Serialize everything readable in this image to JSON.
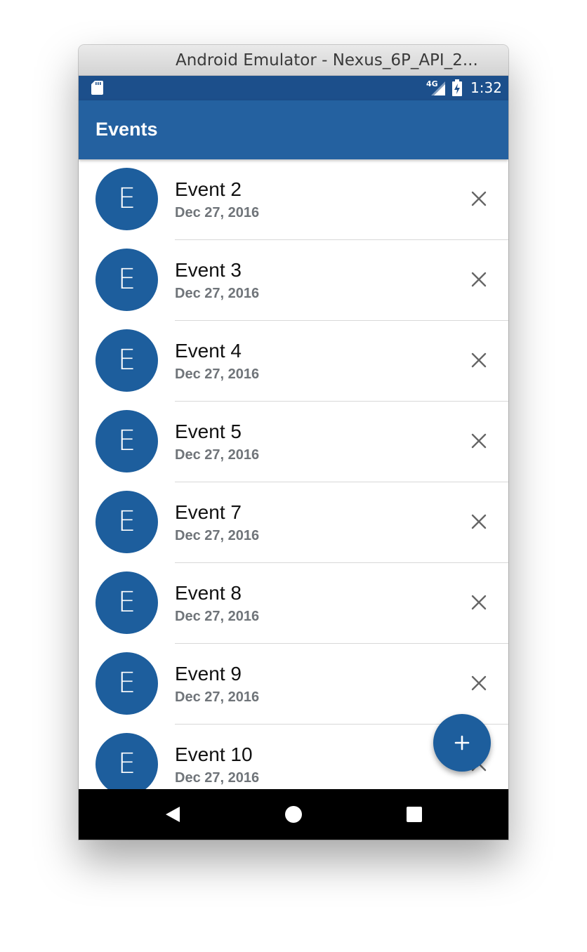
{
  "window": {
    "title": "Android Emulator - Nexus_6P_API_2..."
  },
  "status_bar": {
    "network_label": "4G",
    "time": "1:32",
    "icons": [
      "sd-card-icon",
      "signal-icon",
      "battery-charging-icon"
    ]
  },
  "app_bar": {
    "title": "Events"
  },
  "events": [
    {
      "avatar_letter": "E",
      "title": "Event 2",
      "date": "Dec 27, 2016"
    },
    {
      "avatar_letter": "E",
      "title": "Event 3",
      "date": "Dec 27, 2016"
    },
    {
      "avatar_letter": "E",
      "title": "Event 4",
      "date": "Dec 27, 2016"
    },
    {
      "avatar_letter": "E",
      "title": "Event 5",
      "date": "Dec 27, 2016"
    },
    {
      "avatar_letter": "E",
      "title": "Event 7",
      "date": "Dec 27, 2016"
    },
    {
      "avatar_letter": "E",
      "title": "Event 8",
      "date": "Dec 27, 2016"
    },
    {
      "avatar_letter": "E",
      "title": "Event 9",
      "date": "Dec 27, 2016"
    },
    {
      "avatar_letter": "E",
      "title": "Event 10",
      "date": "Dec 27, 2016"
    }
  ],
  "row_action_icon": "close-icon",
  "fab": {
    "icon": "plus-icon"
  },
  "nav_bar": {
    "buttons": [
      "back-icon",
      "home-icon",
      "recents-icon"
    ]
  },
  "colors": {
    "status_bar": "#1c4f8b",
    "app_bar": "#2461a0",
    "accent": "#1d5e9d",
    "date_text": "#6f7479",
    "nav_bar": "#000000"
  }
}
